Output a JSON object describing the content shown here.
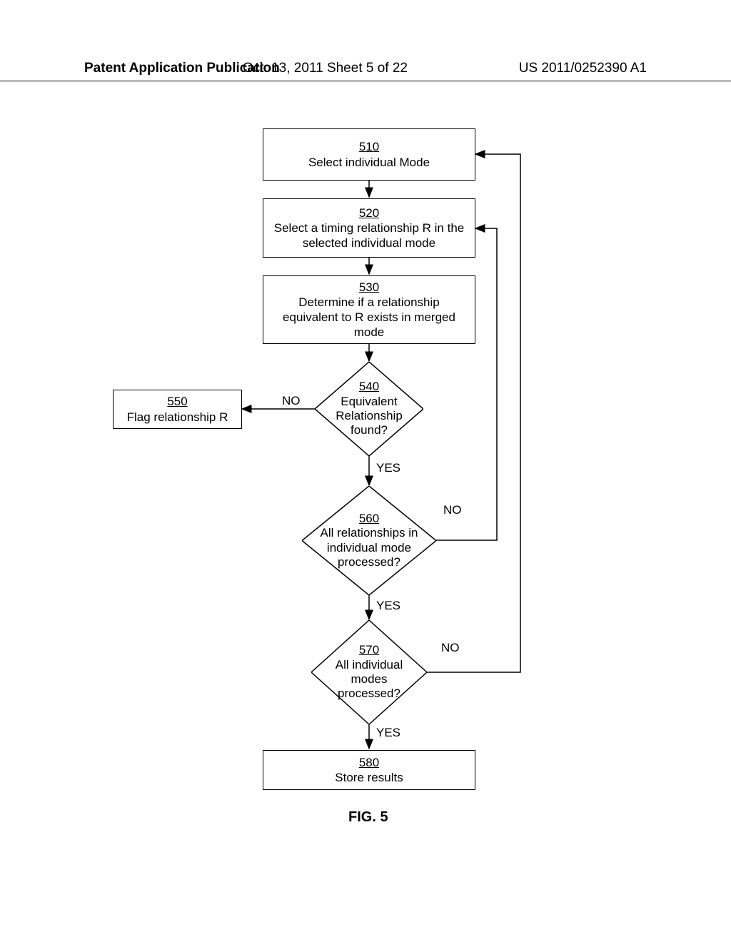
{
  "header": {
    "left": "Patent Application Publication",
    "center": "Oct. 13, 2011   Sheet 5 of 22",
    "right": "US 2011/0252390 A1"
  },
  "boxes": {
    "b510": {
      "num": "510",
      "text": "Select individual Mode"
    },
    "b520": {
      "num": "520",
      "text": "Select a timing relationship R in the selected individual mode"
    },
    "b530": {
      "num": "530",
      "text": "Determine if a relationship equivalent to R exists in merged mode"
    },
    "b540": {
      "num": "540",
      "text": "Equivalent Relationship found?"
    },
    "b550": {
      "num": "550",
      "text": "Flag relationship R"
    },
    "b560": {
      "num": "560",
      "text": "All relationships in individual mode processed?"
    },
    "b570": {
      "num": "570",
      "text": "All individual modes processed?"
    },
    "b580": {
      "num": "580",
      "text": "Store results"
    }
  },
  "labels": {
    "no1": "NO",
    "yes1": "YES",
    "no2": "NO",
    "yes2": "YES",
    "no3": "NO",
    "yes3": "YES"
  },
  "caption": "FIG. 5",
  "chart_data": {
    "type": "flowchart",
    "title": "FIG. 5",
    "nodes": [
      {
        "id": "510",
        "type": "process",
        "label": "Select individual Mode"
      },
      {
        "id": "520",
        "type": "process",
        "label": "Select a timing relationship R in the selected individual mode"
      },
      {
        "id": "530",
        "type": "process",
        "label": "Determine if a relationship equivalent to R exists in merged mode"
      },
      {
        "id": "540",
        "type": "decision",
        "label": "Equivalent Relationship found?"
      },
      {
        "id": "550",
        "type": "process",
        "label": "Flag relationship R"
      },
      {
        "id": "560",
        "type": "decision",
        "label": "All relationships in individual mode processed?"
      },
      {
        "id": "570",
        "type": "decision",
        "label": "All individual modes processed?"
      },
      {
        "id": "580",
        "type": "process",
        "label": "Store results"
      }
    ],
    "edges": [
      {
        "from": "510",
        "to": "520",
        "label": ""
      },
      {
        "from": "520",
        "to": "530",
        "label": ""
      },
      {
        "from": "530",
        "to": "540",
        "label": ""
      },
      {
        "from": "540",
        "to": "550",
        "label": "NO"
      },
      {
        "from": "540",
        "to": "560",
        "label": "YES"
      },
      {
        "from": "560",
        "to": "520",
        "label": "NO"
      },
      {
        "from": "560",
        "to": "570",
        "label": "YES"
      },
      {
        "from": "570",
        "to": "510",
        "label": "NO"
      },
      {
        "from": "570",
        "to": "580",
        "label": "YES"
      }
    ]
  }
}
